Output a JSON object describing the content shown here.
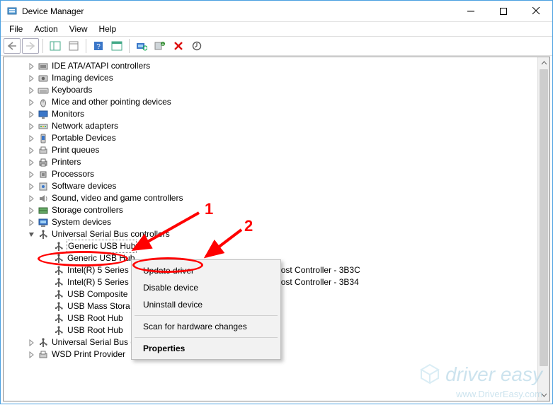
{
  "window": {
    "title": "Device Manager"
  },
  "menubar": {
    "file": "File",
    "action": "Action",
    "view": "View",
    "help": "Help"
  },
  "tree": {
    "nodes": [
      {
        "label": "IDE ATA/ATAPI controllers",
        "icon": "ide"
      },
      {
        "label": "Imaging devices",
        "icon": "imaging"
      },
      {
        "label": "Keyboards",
        "icon": "keyboard"
      },
      {
        "label": "Mice and other pointing devices",
        "icon": "mouse"
      },
      {
        "label": "Monitors",
        "icon": "monitor"
      },
      {
        "label": "Network adapters",
        "icon": "network"
      },
      {
        "label": "Portable Devices",
        "icon": "portable"
      },
      {
        "label": "Print queues",
        "icon": "printq"
      },
      {
        "label": "Printers",
        "icon": "printer"
      },
      {
        "label": "Processors",
        "icon": "cpu"
      },
      {
        "label": "Software devices",
        "icon": "software"
      },
      {
        "label": "Sound, video and game controllers",
        "icon": "sound"
      },
      {
        "label": "Storage controllers",
        "icon": "storage"
      },
      {
        "label": "System devices",
        "icon": "system"
      }
    ],
    "usb": {
      "label": "Universal Serial Bus controllers",
      "children": [
        {
          "label": "Generic USB Hub"
        },
        {
          "label": "Generic USB Hub"
        },
        {
          "label": "Intel(R) 5 Series",
          "suffix": "ost Controller - 3B3C"
        },
        {
          "label": "Intel(R) 5 Series",
          "suffix": "ost Controller - 3B34"
        },
        {
          "label": "USB Composite"
        },
        {
          "label": "USB Mass Stora"
        },
        {
          "label": "USB Root Hub"
        },
        {
          "label": "USB Root Hub"
        }
      ]
    },
    "tail": [
      {
        "label": "Universal Serial Bus devices",
        "icon": "usb"
      },
      {
        "label": "WSD Print Provider",
        "icon": "printq"
      }
    ]
  },
  "context": {
    "update": "Update driver",
    "disable": "Disable device",
    "uninstall": "Uninstall device",
    "scan": "Scan for hardware changes",
    "properties": "Properties"
  },
  "annotations": {
    "one": "1",
    "two": "2"
  },
  "watermark": {
    "brand": "driver easy",
    "url": "www.DriverEasy.com"
  }
}
